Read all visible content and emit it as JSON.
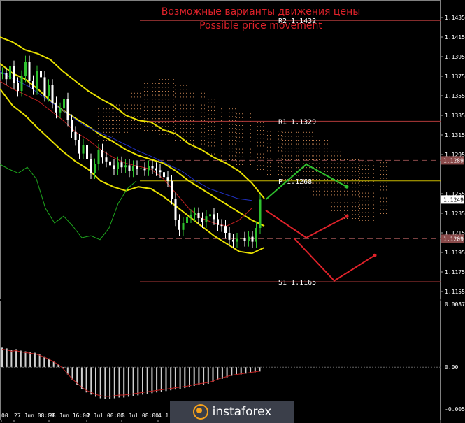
{
  "chart_data": [
    {
      "type": "line",
      "panel": "price",
      "title": "Возможные варианты движения цены",
      "subtitle": "Possible price movement",
      "ylim": [
        1.115,
        1.145
      ],
      "y_ticks": [
        "1.1435",
        "1.1415",
        "1.1395",
        "1.1375",
        "1.1355",
        "1.1335",
        "1.1315",
        "1.1295",
        "1.1255",
        "1.1235",
        "1.1215",
        "1.1195",
        "1.1175",
        "1.1155"
      ],
      "x_ticks": [
        "00",
        "27 Jun 08:00",
        "28 Jun 16:00",
        "2 Jul 00:00",
        "3 Jul 08:00",
        "4 Jul"
      ],
      "price_tags": [
        {
          "value": "1.1289",
          "color": "#8a4a4a"
        },
        {
          "value": "1.1249",
          "color": "#ffffff"
        },
        {
          "value": "1.1209",
          "color": "#8a4a4a"
        }
      ],
      "levels": [
        {
          "label": "R2 1.1432",
          "value": 1.1432,
          "color": "#b03a3a"
        },
        {
          "label": "R1 1.1329",
          "value": 1.1329,
          "color": "#b03a3a"
        },
        {
          "label": "P 1.1268",
          "value": 1.1268,
          "color": "#c8b800"
        },
        {
          "label": "S1 1.1165",
          "value": 1.1165,
          "color": "#b03a3a"
        }
      ],
      "dashed_levels": [
        1.1289,
        1.1209
      ],
      "close_series": [
        1.1378,
        1.1372,
        1.1385,
        1.1368,
        1.136,
        1.1375,
        1.139,
        1.137,
        1.1362,
        1.138,
        1.1374,
        1.1355,
        1.1366,
        1.1348,
        1.1338,
        1.1342,
        1.1352,
        1.133,
        1.1318,
        1.131,
        1.1296,
        1.1305,
        1.129,
        1.1276,
        1.1285,
        1.13,
        1.1292,
        1.1288,
        1.1284,
        1.128,
        1.1287,
        1.1282,
        1.1284,
        1.1278,
        1.1283,
        1.128,
        1.1281,
        1.1279,
        1.1283,
        1.1281,
        1.1279,
        1.1277,
        1.1272,
        1.1268,
        1.125,
        1.1228,
        1.1218,
        1.1225,
        1.1231,
        1.1233,
        1.1235,
        1.123,
        1.1226,
        1.1232,
        1.1234,
        1.1229,
        1.1223,
        1.1222,
        1.1215,
        1.1208,
        1.1206,
        1.1209,
        1.121,
        1.1207,
        1.1211,
        1.1206,
        1.122,
        1.1249
      ],
      "bollinger_upper": [
        1.1415,
        1.141,
        1.1402,
        1.1398,
        1.1392,
        1.138,
        1.137,
        1.136,
        1.1352,
        1.1345,
        1.1335,
        1.133,
        1.1328,
        1.132,
        1.1316,
        1.1306,
        1.13,
        1.1292,
        1.1286,
        1.1278,
        1.1266,
        1.125
      ],
      "bollinger_middle": [
        1.1388,
        1.1378,
        1.1372,
        1.1362,
        1.135,
        1.134,
        1.1332,
        1.1324,
        1.1315,
        1.1308,
        1.13,
        1.1294,
        1.129,
        1.1286,
        1.1278,
        1.1268,
        1.126,
        1.1252,
        1.1244,
        1.1236,
        1.1228,
        1.1222
      ],
      "bollinger_lower": [
        1.1362,
        1.1345,
        1.1335,
        1.1322,
        1.131,
        1.1298,
        1.1288,
        1.128,
        1.1268,
        1.1262,
        1.1258,
        1.1262,
        1.126,
        1.1252,
        1.1242,
        1.1232,
        1.1222,
        1.1212,
        1.1204,
        1.1196,
        1.1194,
        1.12
      ],
      "forecast_paths": [
        {
          "color": "#2ec22e",
          "points": [
            [
              1.1249,
              0
            ],
            [
              1.1285,
              1
            ],
            [
              1.1262,
              2
            ]
          ]
        },
        {
          "color": "#e0222a",
          "points": [
            [
              1.1238,
              0
            ],
            [
              1.121,
              1
            ],
            [
              1.1232,
              2
            ]
          ]
        },
        {
          "color": "#e0222a",
          "points": [
            [
              1.121,
              0
            ],
            [
              1.1166,
              1
            ],
            [
              1.1192,
              2
            ]
          ]
        }
      ]
    },
    {
      "type": "bar",
      "panel": "oscillator",
      "ylim": [
        -0.0058,
        0.00875
      ],
      "y_ticks": [
        "0.00875",
        "0.00",
        "-0.0058"
      ],
      "values": [
        0.0027,
        0.0026,
        0.0024,
        0.0025,
        0.0023,
        0.0022,
        0.0021,
        0.002,
        0.0018,
        0.0015,
        0.0012,
        0.0008,
        0.0004,
        -0.0002,
        -0.001,
        -0.0018,
        -0.0024,
        -0.003,
        -0.0035,
        -0.0038,
        -0.0041,
        -0.0043,
        -0.0044,
        -0.0044,
        -0.0043,
        -0.0042,
        -0.0042,
        -0.0041,
        -0.004,
        -0.0039,
        -0.0038,
        -0.0037,
        -0.0036,
        -0.0035,
        -0.0034,
        -0.0033,
        -0.0032,
        -0.0031,
        -0.003,
        -0.0029,
        -0.0028,
        -0.0026,
        -0.0025,
        -0.0024,
        -0.0023,
        -0.0021,
        -0.0018,
        -0.0016,
        -0.0014,
        -0.0012,
        -0.0011,
        -0.001,
        -0.0009,
        -0.0008,
        -0.0007,
        -0.0006
      ]
    }
  ],
  "brand": {
    "name": "instaforex"
  }
}
